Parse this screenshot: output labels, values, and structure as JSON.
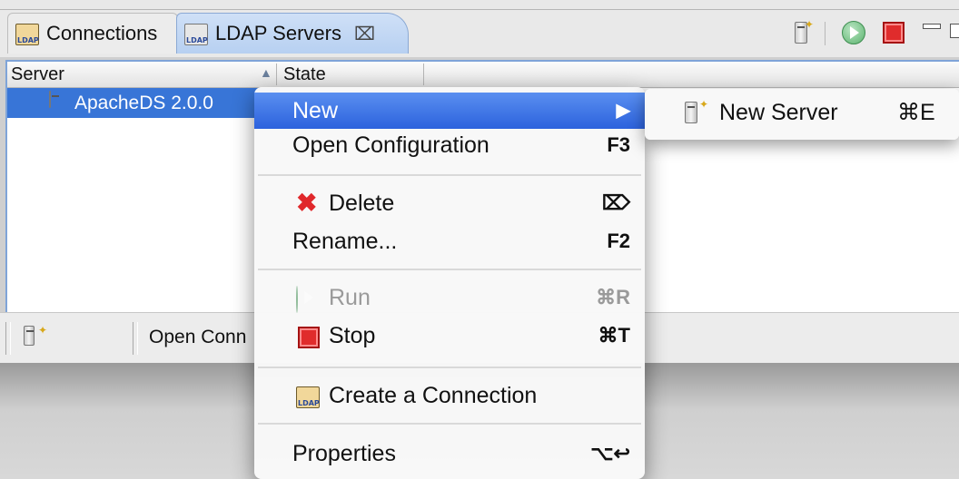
{
  "tabs": [
    {
      "label": "Connections",
      "icon": "ldap-connections-icon"
    },
    {
      "label": "LDAP Servers",
      "icon": "ldap-servers-icon",
      "close": "⌧"
    }
  ],
  "toolbar": {
    "new_server_icon": "new-server-icon",
    "run_icon": "run-icon",
    "stop_icon": "stop-icon",
    "minimize_icon": "minimize-icon"
  },
  "table": {
    "columns": [
      "Server",
      "State"
    ],
    "sort_indicator": "▲",
    "rows": [
      {
        "server": "ApacheDS 2.0.0",
        "state": ""
      }
    ]
  },
  "bottom_bar": {
    "text": "Open Conn"
  },
  "context_menu": {
    "items": [
      {
        "label": "New",
        "shortcut": "▶"
      },
      {
        "label": "Open Configuration",
        "shortcut": "F3"
      },
      {
        "label": "Delete",
        "shortcut": "⌦"
      },
      {
        "label": "Rename...",
        "shortcut": "F2"
      },
      {
        "label": "Run",
        "shortcut": "⌘R"
      },
      {
        "label": "Stop",
        "shortcut": "⌘T"
      },
      {
        "label": "Create a Connection",
        "shortcut": ""
      },
      {
        "label": "Properties",
        "shortcut": "⌥↩"
      }
    ]
  },
  "submenu": {
    "label": "New Server",
    "shortcut": "⌘E"
  },
  "colors": {
    "selection": "#3875d7",
    "menu_highlight": "#2c62dd",
    "stop_red": "#e02c2c",
    "run_green": "#5cb36f"
  }
}
